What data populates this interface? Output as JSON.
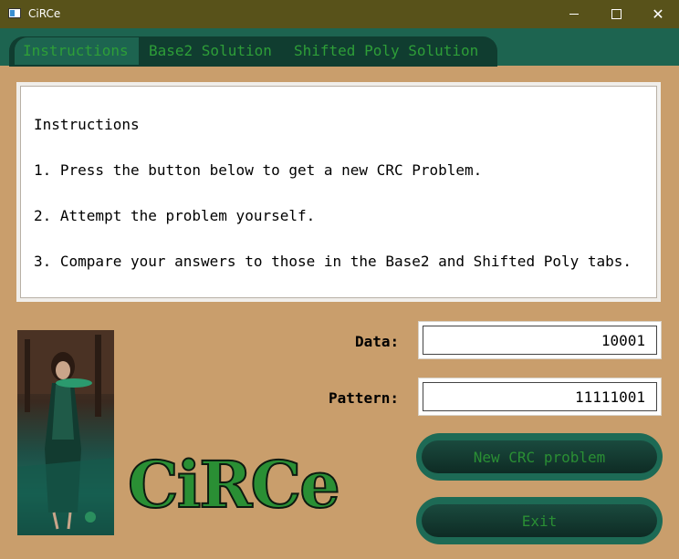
{
  "window": {
    "title": "CiRCe"
  },
  "tabs": [
    {
      "label": "Instructions",
      "active": true
    },
    {
      "label": "Base2 Solution",
      "active": false
    },
    {
      "label": "Shifted Poly Solution",
      "active": false
    }
  ],
  "instructions": {
    "heading": "Instructions",
    "step1": "1. Press the button below to get a new CRC Problem.",
    "step2": "2. Attempt the problem yourself.",
    "step3": "3. Compare your answers to those in the Base2 and Shifted Poly tabs."
  },
  "form": {
    "data_label": "Data:",
    "data_value": "10001",
    "pattern_label": "Pattern:",
    "pattern_value": "11111001"
  },
  "buttons": {
    "new_problem": "New CRC problem",
    "exit": "Exit"
  },
  "logo_text": "CiRCe",
  "colors": {
    "titlebar": "#58521a",
    "background": "#c99e6c",
    "accent": "#1d6450",
    "text_green": "#2e9e38"
  }
}
